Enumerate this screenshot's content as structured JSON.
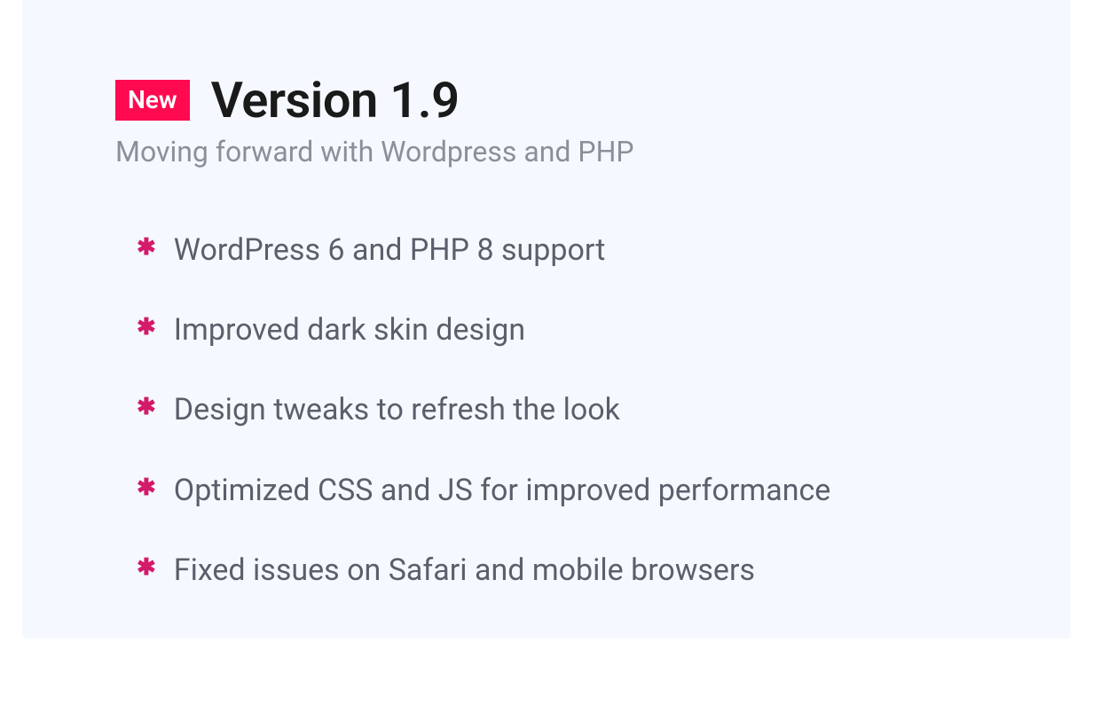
{
  "badge": "New",
  "title": "Version 1.9",
  "subtitle": "Moving forward with Wordpress and PHP",
  "features": [
    "WordPress 6 and PHP 8 support",
    "Improved dark skin design",
    "Design tweaks to refresh the look",
    "Optimized CSS and JS for improved performance",
    "Fixed issues on Safari and mobile browsers"
  ],
  "colors": {
    "badge_bg": "#ff0a50",
    "bullet": "#d41a6a",
    "card_bg": "#f5f9ff"
  }
}
